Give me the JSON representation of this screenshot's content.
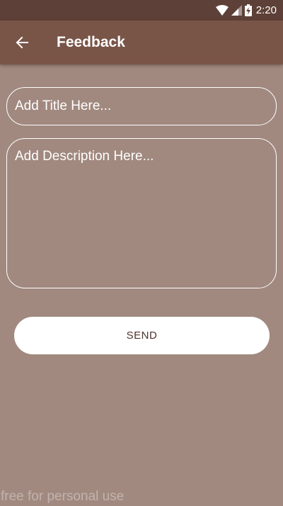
{
  "status_bar": {
    "time": "2:20",
    "icons": [
      "wifi-icon",
      "signal-icon",
      "battery-charging-icon"
    ]
  },
  "app_bar": {
    "title": "Feedback",
    "back_icon": "arrow-left-icon"
  },
  "form": {
    "title_placeholder": "Add Title Here...",
    "title_value": "",
    "description_placeholder": "Add Description Here...",
    "description_value": "",
    "send_label": "SEND"
  },
  "watermark": "free for personal use",
  "colors": {
    "status_bar": "#5d4037",
    "app_bar": "#795548",
    "background": "#a1897f",
    "button_bg": "#ffffff",
    "button_text": "#4e342e"
  }
}
